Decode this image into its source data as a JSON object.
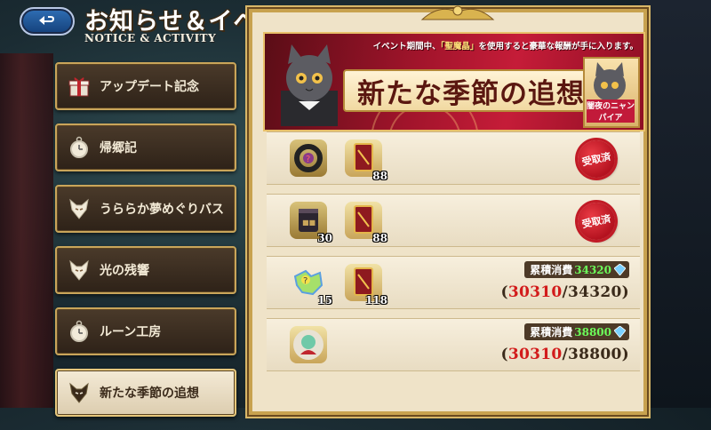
{
  "header": {
    "title": "お知らせ＆イベント",
    "subtitle": "NOTICE & ACTIVITY"
  },
  "sidebar": {
    "items": [
      {
        "label": "アップデート記念",
        "icon": "gift-box-icon",
        "active": false
      },
      {
        "label": "帰郷記",
        "icon": "pocket-watch-icon",
        "active": false
      },
      {
        "label": "うららか夢めぐりバス",
        "icon": "fox-mask-icon",
        "active": false
      },
      {
        "label": "光の残響",
        "icon": "fox-mask-icon",
        "active": false
      },
      {
        "label": "ルーン工房",
        "icon": "pocket-watch-icon",
        "active": false
      },
      {
        "label": "新たな季節の追想",
        "icon": "fox-mask-icon",
        "active": true
      }
    ]
  },
  "banner": {
    "note_pre": "イベント期間中、",
    "note_highlight": "「聖魔晶」",
    "note_post": "を使用すると豪華な報酬が手に入ります。",
    "title": "新たな季節の追想",
    "portrait_tag": "闇夜のニャンパイア"
  },
  "rewards": [
    {
      "items": [
        {
          "icon": "black-ring-icon",
          "qty": ""
        },
        {
          "icon": "red-card-icon",
          "qty": "88"
        }
      ],
      "status": "受取済"
    },
    {
      "items": [
        {
          "icon": "dark-jar-icon",
          "qty": "30"
        },
        {
          "icon": "red-card-icon",
          "qty": "88"
        }
      ],
      "status": "受取済"
    },
    {
      "items": [
        {
          "icon": "rainbow-puzzle-icon",
          "qty": "15"
        },
        {
          "icon": "red-card-icon",
          "qty": "118"
        }
      ],
      "cum_label": "累積消費",
      "cum_value": "34320",
      "current": "30310",
      "target": "/34320)"
    },
    {
      "items": [
        {
          "icon": "creature-portrait-icon",
          "qty": ""
        }
      ],
      "cum_label": "累積消費",
      "cum_value": "38800",
      "current": "30310",
      "target": "/38800)"
    }
  ],
  "ratio_open": "(",
  "colors": {
    "accent_gold": "#c8a24f",
    "banner_red": "#c51c38",
    "seal_red": "#b4121f",
    "progress_red": "#d21b1b",
    "cum_green": "#6cff5a"
  }
}
